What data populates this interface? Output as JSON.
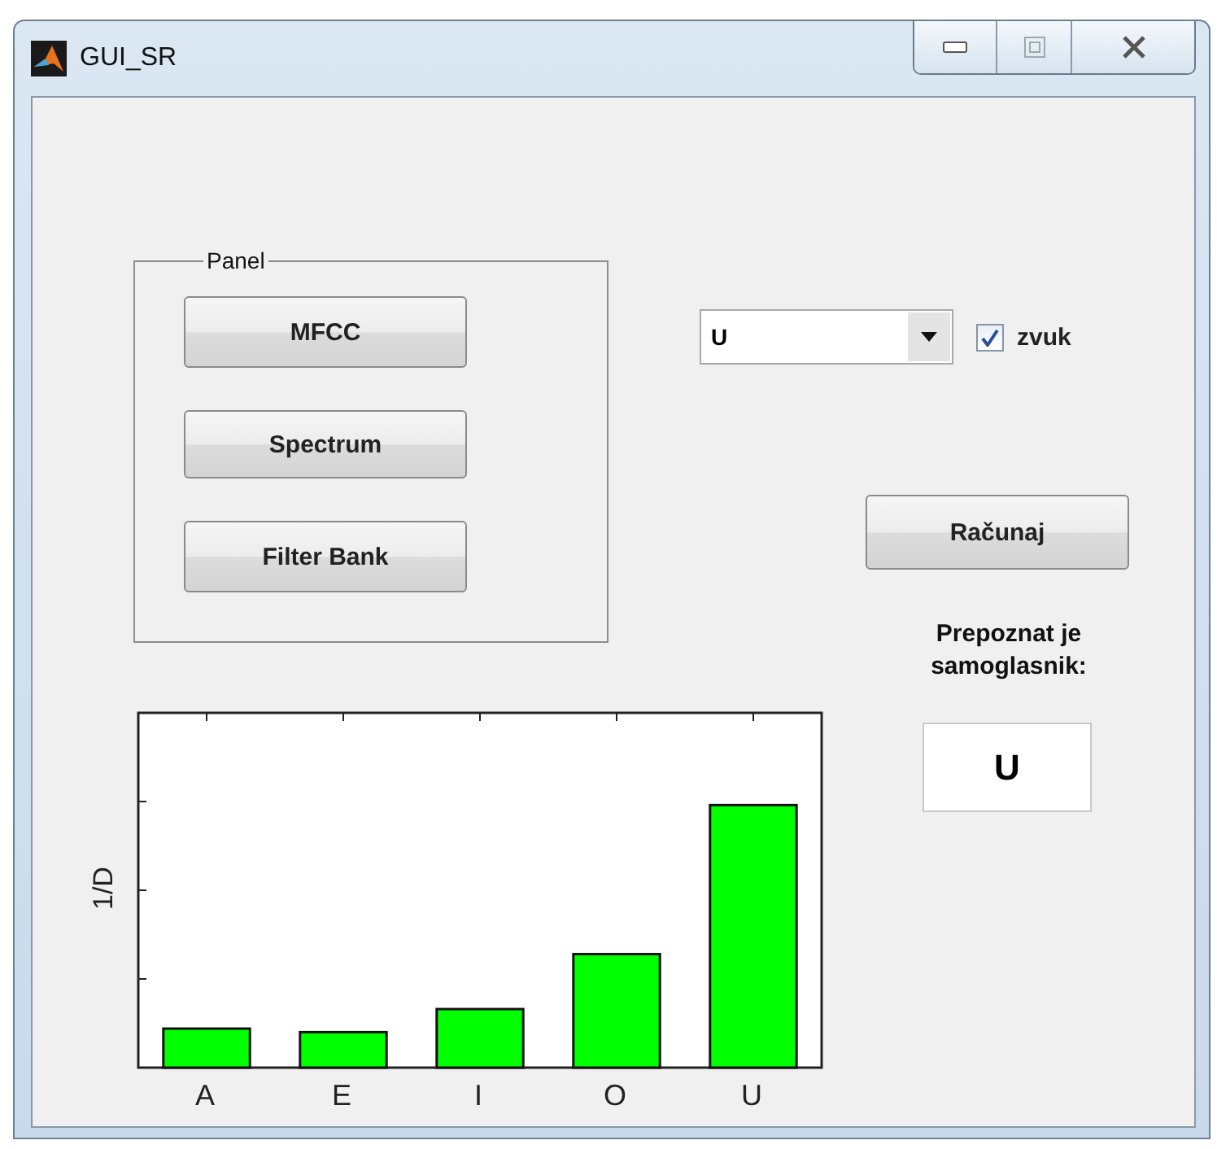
{
  "window": {
    "title": "GUI_SR"
  },
  "panel": {
    "title": "Panel",
    "buttons": [
      {
        "label": "MFCC"
      },
      {
        "label": "Spectrum"
      },
      {
        "label": "Filter Bank"
      }
    ]
  },
  "vowel_select": {
    "value": "U"
  },
  "sound_checkbox": {
    "label": "zvuk",
    "checked": true
  },
  "compute_button": {
    "label": "Računaj"
  },
  "result": {
    "label": "Prepoznat je samoglasnik:",
    "value": "U"
  },
  "chart": {
    "ylabel": "1/D",
    "categories": [
      "A",
      "E",
      "I",
      "O",
      "U"
    ]
  }
}
